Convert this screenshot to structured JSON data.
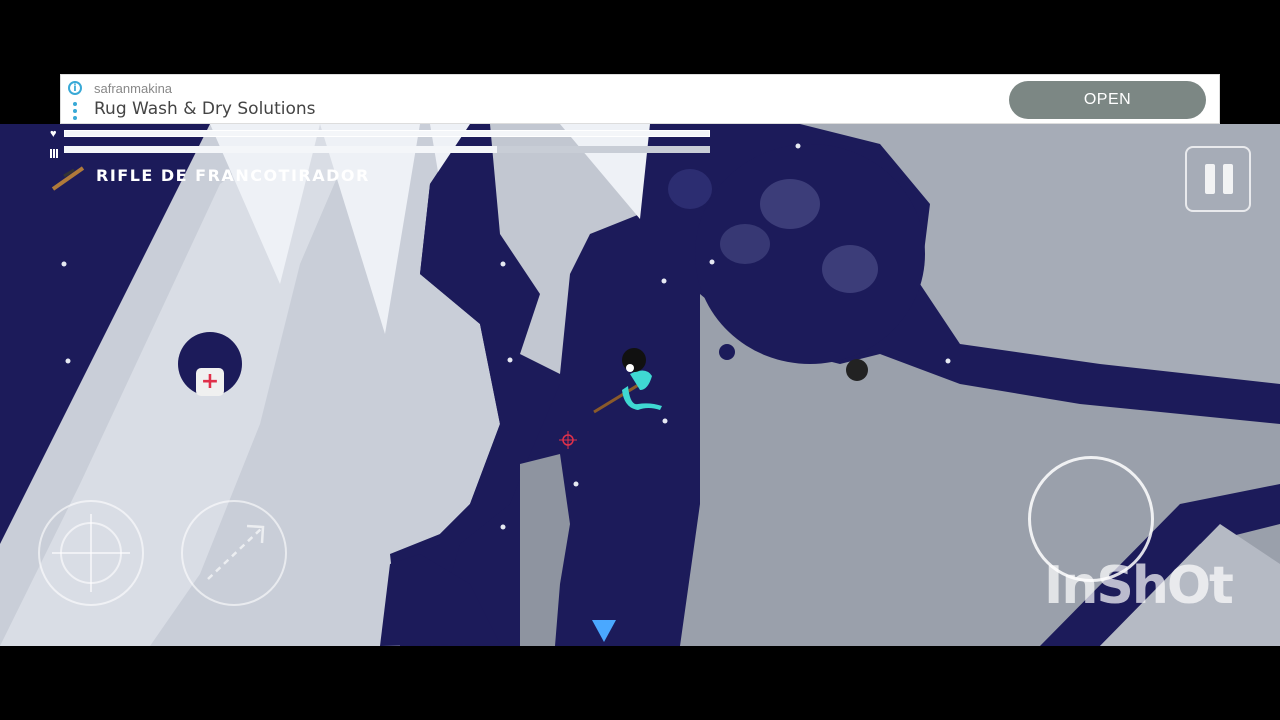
{
  "ad": {
    "advertiser": "safranmakina",
    "headline": "Rug Wash & Dry Solutions",
    "cta": "OPEN",
    "info_icon": "info-icon"
  },
  "hud": {
    "health_icon": "heart-icon",
    "ammo_icon": "ammo-icon",
    "health_level": 1.0,
    "ammo_level": 0.67,
    "weapon_name": "RIFLE DE FRANCOTIRADOR",
    "weapon_icon": "sniper-rifle-icon"
  },
  "controls": {
    "pause_icon": "pause-icon",
    "aim_icon": "crosshair-icon",
    "dash_icon": "dashed-arrow-icon",
    "joystick": "movement-joystick"
  },
  "watermark": "InShOt",
  "colors": {
    "sky": "#1c1b5a",
    "terrain": "#9aa0ab",
    "terrain_light": "#c9ced8",
    "ice": "#e8ecf3",
    "player": "#3fd8d2",
    "reticle": "#e0304a",
    "marker": "#4aa8ff"
  }
}
